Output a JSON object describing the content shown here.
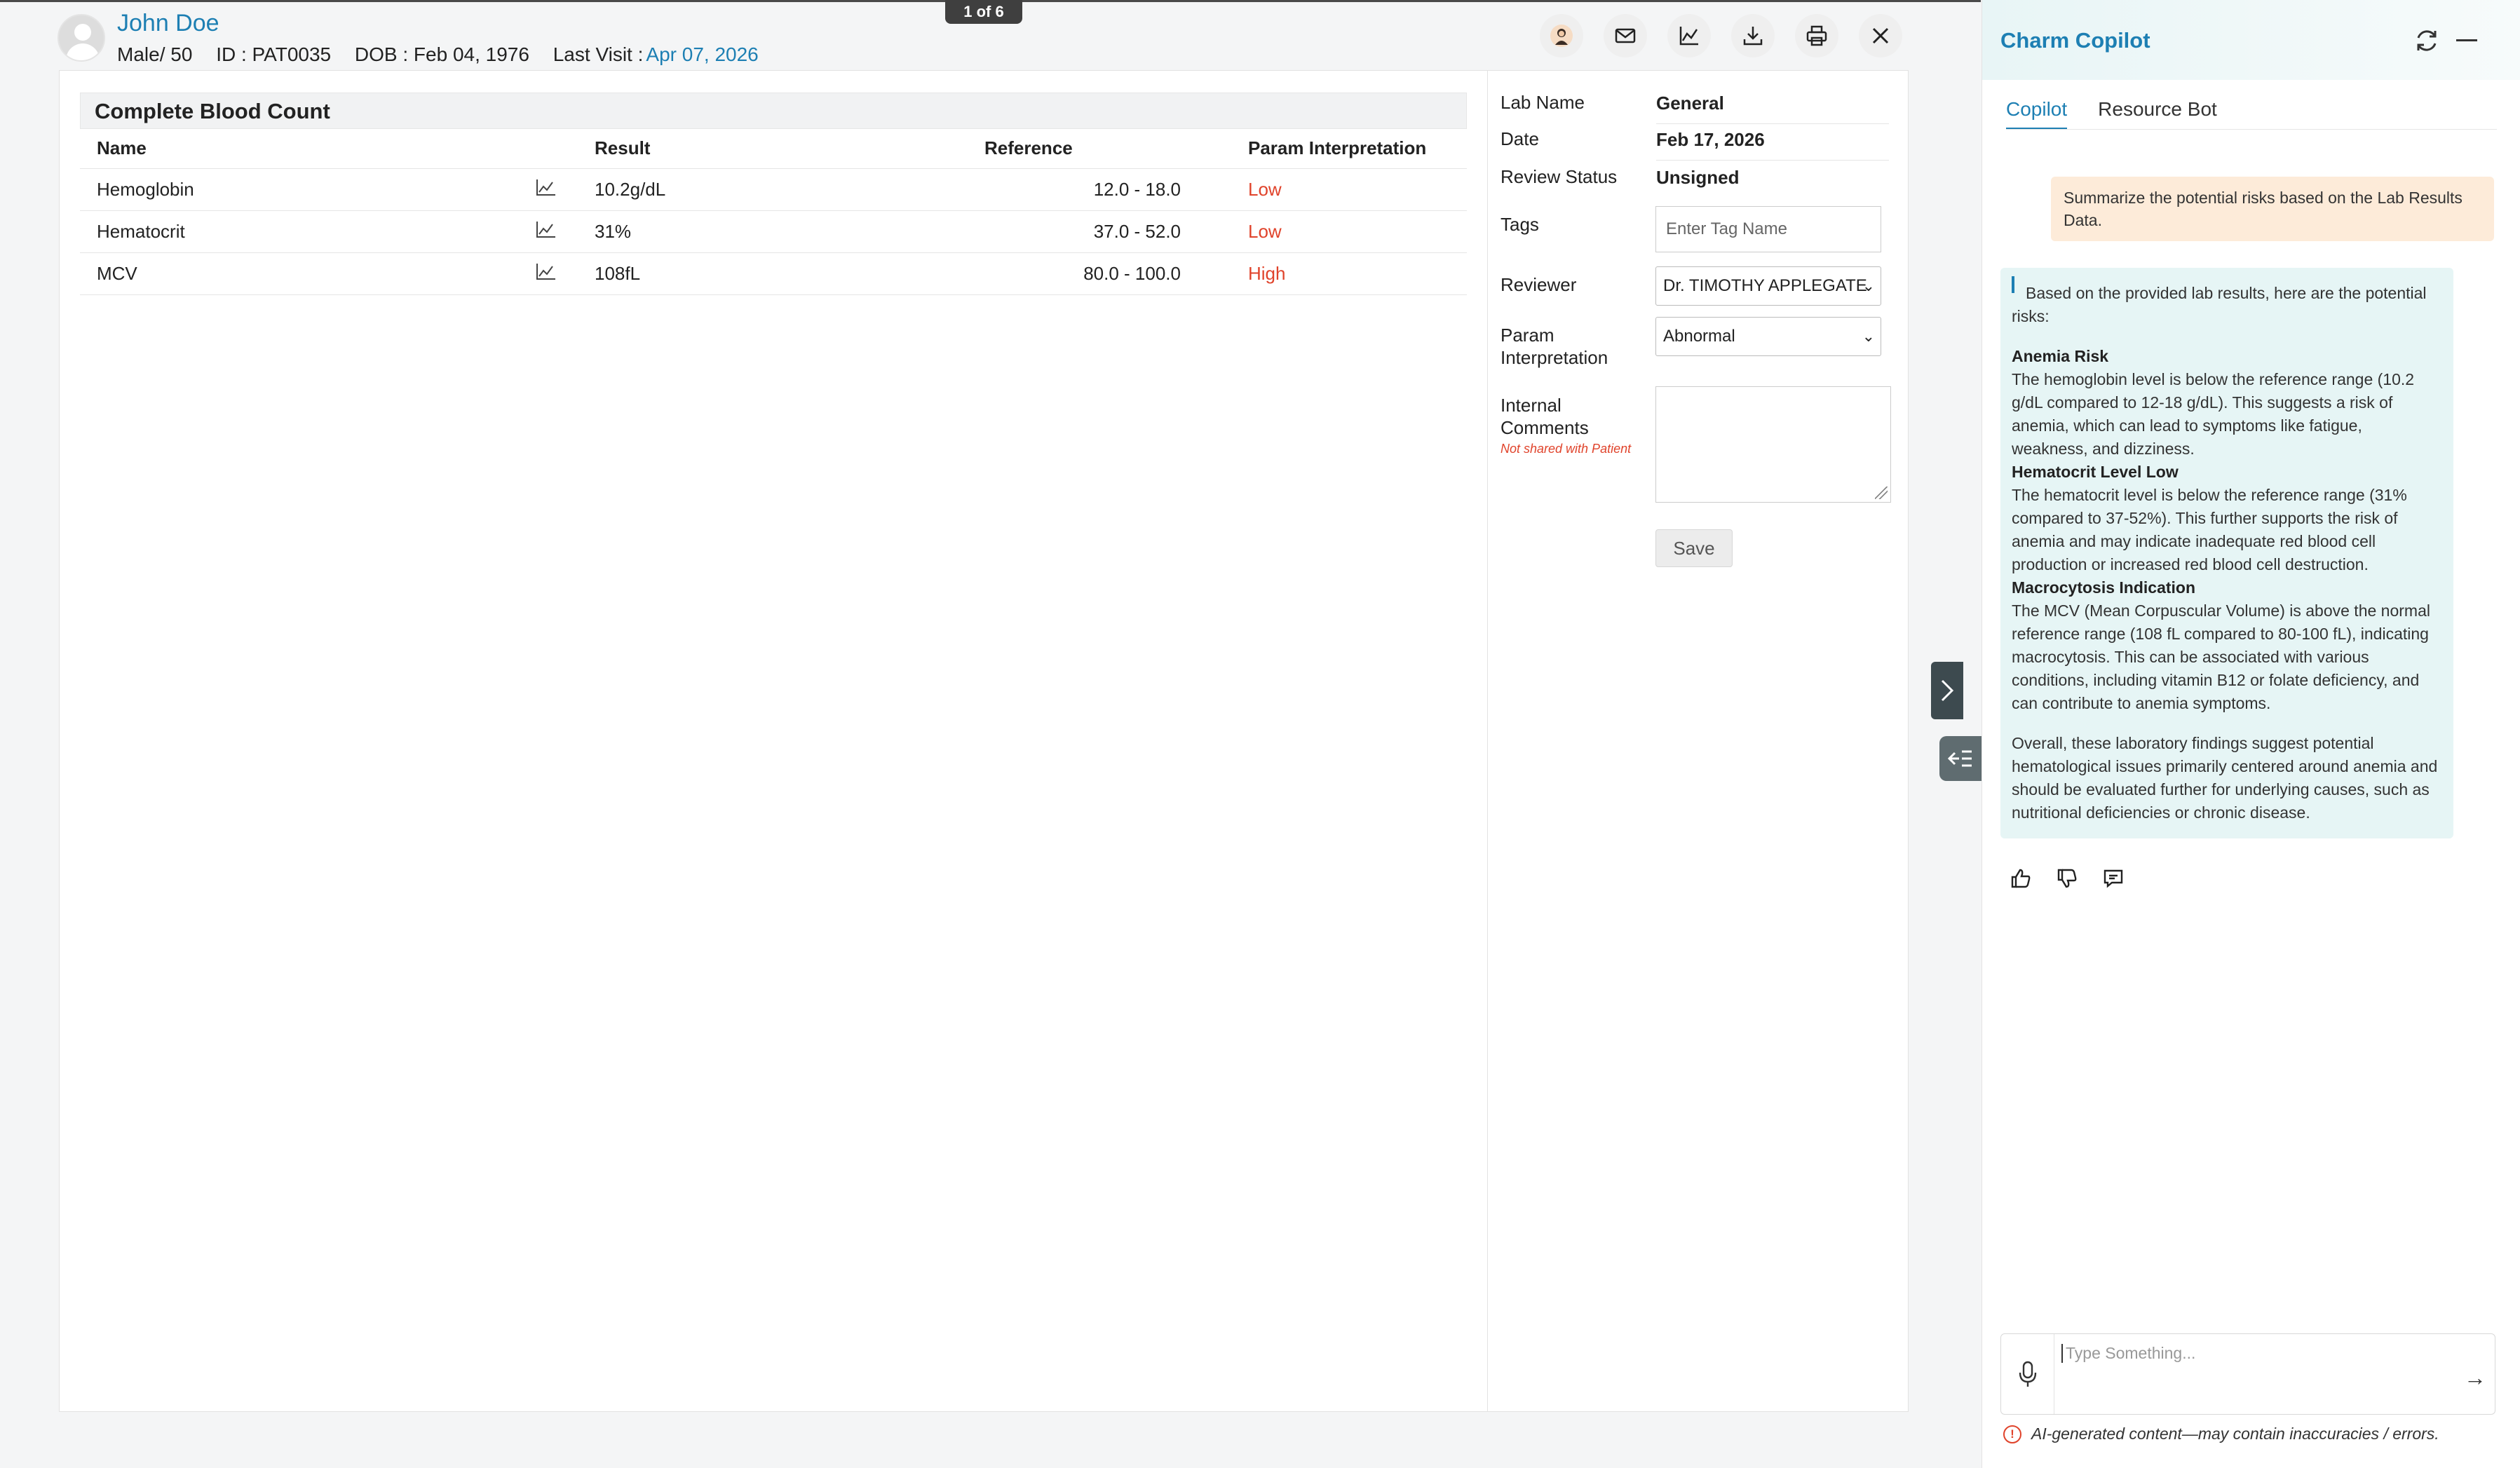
{
  "pager": "1 of 6",
  "patient": {
    "name": "John Doe",
    "gender_age": "Male/ 50",
    "id": "ID : PAT0035",
    "dob": "DOB  : Feb 04, 1976",
    "last_visit_label": "Last Visit  :",
    "last_visit": "Apr 07, 2026"
  },
  "header_icons": [
    "user-icon",
    "mail-icon",
    "trend-chart-icon",
    "download-icon",
    "print-icon",
    "close-icon"
  ],
  "lab": {
    "title": "Complete Blood Count",
    "columns": [
      "Name",
      "Result",
      "Reference",
      "Param Interpretation"
    ],
    "rows": [
      {
        "name": "Hemoglobin",
        "result": "10.2g/dL",
        "reference": "12.0 - 18.0",
        "interpretation": "Low"
      },
      {
        "name": "Hematocrit",
        "result": "31%",
        "reference": "37.0 - 52.0",
        "interpretation": "Low"
      },
      {
        "name": "MCV",
        "result": "108fL",
        "reference": "80.0 - 100.0",
        "interpretation": "High"
      }
    ]
  },
  "details": {
    "lab_name_label": "Lab Name",
    "lab_name": "General",
    "date_label": "Date",
    "date": "Feb 17, 2026",
    "review_status_label": "Review Status",
    "review_status": "Unsigned",
    "tags_label": "Tags",
    "tags_placeholder": "Enter Tag Name",
    "reviewer_label": "Reviewer",
    "reviewer": "Dr. TIMOTHY APPLEGATE",
    "param_label_1": "Param",
    "param_label_2": "Interpretation",
    "param_value": "Abnormal",
    "comments_label_1": "Internal",
    "comments_label_2": "Comments",
    "not_shared": "Not shared with Patient",
    "save": "Save"
  },
  "copilot": {
    "title": "Charm Copilot",
    "tabs": [
      "Copilot",
      "Resource Bot"
    ],
    "user_message": "Summarize the potential risks based on the Lab Results Data.",
    "bot": {
      "intro": "Based on the provided lab results, here are the potential risks:",
      "h1": "Anemia Risk",
      "p1": "The hemoglobin level is below the reference range (10.2 g/dL compared to 12-18 g/dL). This suggests a risk of anemia, which can lead to symptoms like fatigue, weakness, and dizziness.",
      "h2": "Hematocrit Level Low",
      "p2": "The hematocrit level is below the reference range (31% compared to 37-52%). This further supports the risk of anemia and may indicate inadequate red blood cell production or increased red blood cell destruction.",
      "h3": "Macrocytosis Indication",
      "p3": "The MCV (Mean Corpuscular Volume) is above the normal reference range (108 fL compared to 80-100 fL), indicating macrocytosis. This can be associated with various conditions, including vitamin B12 or folate deficiency, and can contribute to anemia symptoms.",
      "summary": "Overall, these laboratory findings suggest potential hematological issues primarily centered around anemia and should be evaluated further for underlying causes, such as nutritional deficiencies or chronic disease."
    },
    "input_placeholder": "Type Something...",
    "disclaimer": "AI-generated content—may contain inaccuracies / errors."
  },
  "colors": {
    "accent": "#1d7fb3",
    "alert": "#e0432b",
    "user_bubble": "#fdebd9",
    "bot_bubble": "#e6f5f5"
  }
}
